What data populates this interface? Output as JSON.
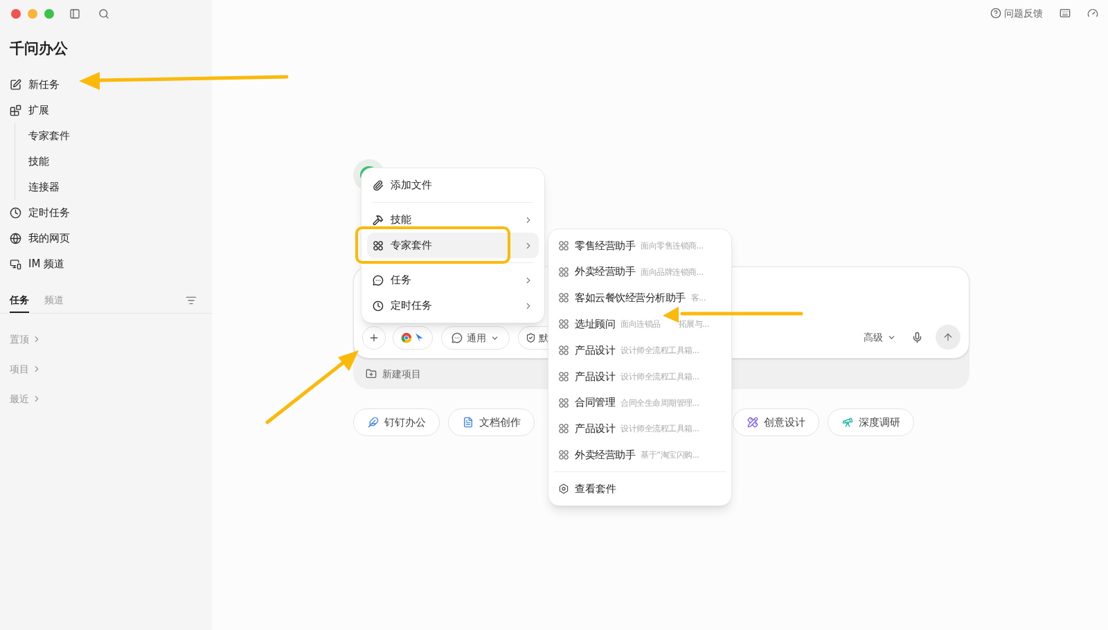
{
  "app": {
    "title": "千问办公"
  },
  "sidebar": {
    "items": [
      {
        "label": "新任务"
      },
      {
        "label": "扩展",
        "children": [
          {
            "label": "专家套件"
          },
          {
            "label": "技能"
          },
          {
            "label": "连接器"
          }
        ]
      },
      {
        "label": "定时任务"
      },
      {
        "label": "我的网页"
      },
      {
        "label": "IM 频道"
      }
    ],
    "tabs": [
      {
        "label": "任务",
        "selected": true
      },
      {
        "label": "频道",
        "selected": false
      }
    ],
    "groups": [
      {
        "label": "置顶"
      },
      {
        "label": "项目"
      },
      {
        "label": "最近"
      }
    ]
  },
  "top_bar": {
    "feedback": "问题反馈"
  },
  "composer": {
    "mode": "通用",
    "permission": "默",
    "level": "高级",
    "project": "新建项目"
  },
  "shortcuts": [
    {
      "label": "钉钉办公"
    },
    {
      "label": "文档创作"
    },
    {
      "label": "创意设计"
    },
    {
      "label": "深度调研"
    }
  ],
  "menu": {
    "items": [
      {
        "label": "添加文件",
        "submenu": false,
        "selected": false
      },
      {
        "label": "技能",
        "submenu": true,
        "selected": false
      },
      {
        "label": "专家套件",
        "submenu": true,
        "selected": true
      },
      {
        "label": "任务",
        "submenu": true,
        "selected": false
      },
      {
        "label": "定时任务",
        "submenu": true,
        "selected": false
      }
    ]
  },
  "submenu": {
    "items": [
      {
        "name": "零售经营助手",
        "description": "面向零售连锁商..."
      },
      {
        "name": "外卖经营助手",
        "description": "面向品牌连锁商..."
      },
      {
        "name": "客如云餐饮经营分析助手",
        "description": "客..."
      },
      {
        "name": "选址顾问",
        "description": "面向连锁品",
        "description_tail": "拓展与..."
      },
      {
        "name": "产品设计",
        "description": "设计师全流程工具箱..."
      },
      {
        "name": "产品设计",
        "description": "设计师全流程工具箱..."
      },
      {
        "name": "合同管理",
        "description": "合同全生命周期管理..."
      },
      {
        "name": "产品设计",
        "description": "设计师全流程工具箱..."
      },
      {
        "name": "外卖经营助手",
        "description": "基于“淘宝闪购..."
      }
    ],
    "footer": "查看套件"
  }
}
